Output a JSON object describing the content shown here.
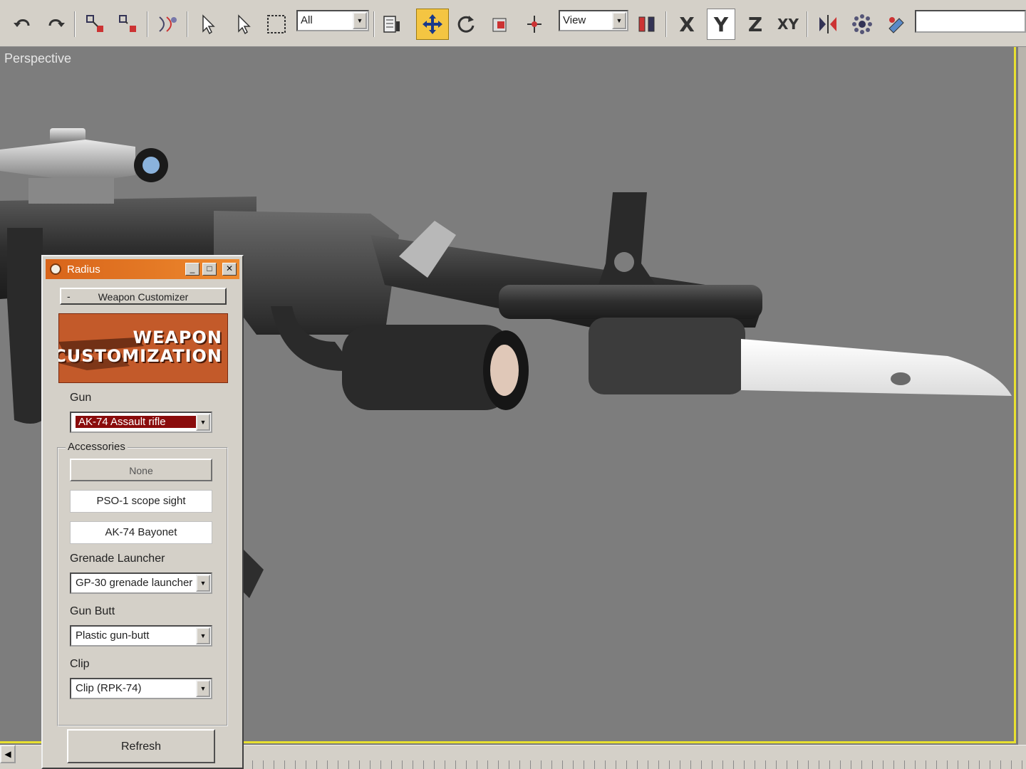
{
  "toolbar": {
    "selection_filter": "All",
    "coord_system": "View",
    "axis_x": "X",
    "axis_y": "Y",
    "axis_z": "Z",
    "axis_xy": "XY",
    "buttons": [
      "undo-icon",
      "redo-icon",
      "select-and-link-icon",
      "unlink-icon",
      "bind-space-warp-icon",
      "select-object-icon",
      "select-by-name-icon",
      "rectangular-selection-icon",
      "named-selection-icon",
      "move-icon",
      "rotate-icon",
      "scale-icon",
      "manipulate-icon",
      "use-pivot-center-icon",
      "mirror-icon",
      "array-icon",
      "align-icon"
    ],
    "accent_color": "#f4c542"
  },
  "viewport": {
    "label": "Perspective",
    "border_color": "#e8e030"
  },
  "panel": {
    "title": "Radius",
    "rollout_header": "Weapon Customizer",
    "banner": {
      "line1": "WEAPON",
      "line2": "CUSTOMIZATION"
    },
    "gun": {
      "label": "Gun",
      "value": "AK-74 Assault rifle"
    },
    "accessories": {
      "label": "Accessories",
      "none_button": "None",
      "scope": "PSO-1 scope sight",
      "bayonet": "AK-74 Bayonet"
    },
    "grenade_launcher": {
      "label": "Grenade Launcher",
      "value": "GP-30 grenade launcher"
    },
    "gun_butt": {
      "label": "Gun Butt",
      "value": "Plastic gun-butt"
    },
    "clip": {
      "label": "Clip",
      "value": "Clip (RPK-74)"
    },
    "refresh_button": "Refresh",
    "title_bar_color": "#e07020"
  }
}
